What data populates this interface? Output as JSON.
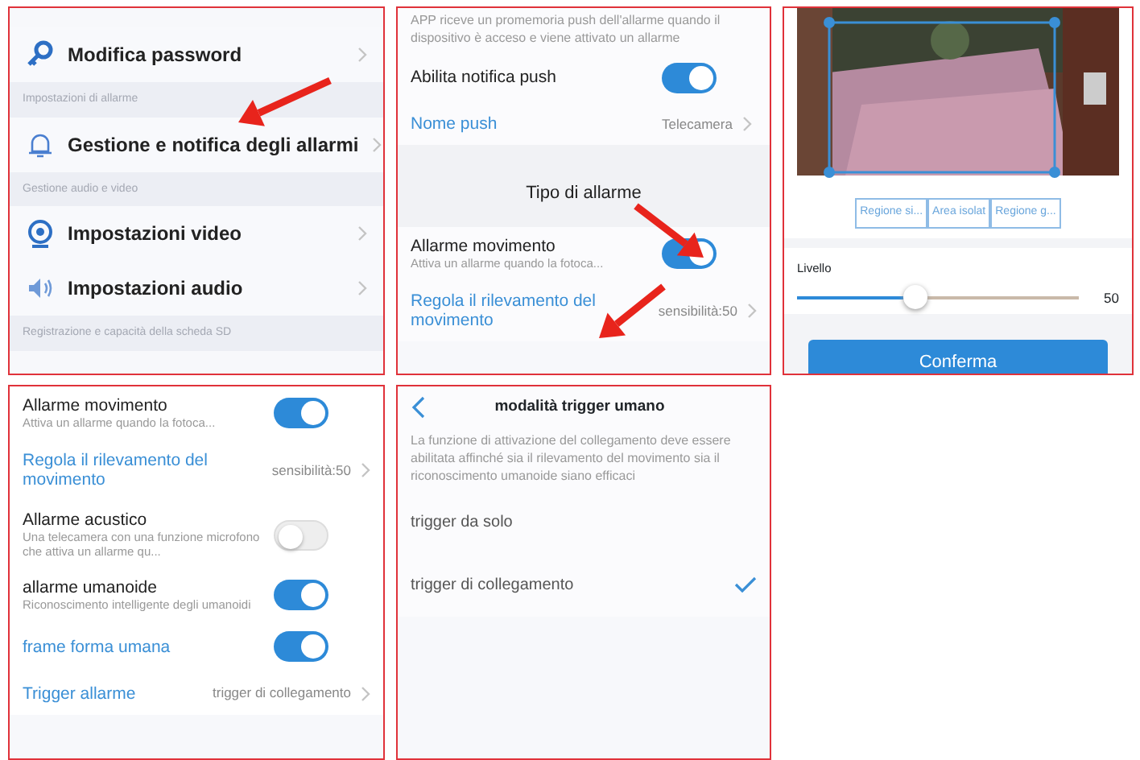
{
  "panels": [
    {
      "kind": "list",
      "rows": [
        {
          "kind": "nav",
          "label": "Modifica password"
        },
        {
          "kind": "header",
          "text": "Impostazioni di allarme"
        },
        {
          "kind": "nav",
          "label": "Gestione e notifica degli allarmi"
        },
        {
          "kind": "header",
          "text": "Gestione audio e video"
        },
        {
          "kind": "nav",
          "label": "Impostazioni video"
        },
        {
          "kind": "nav",
          "label": "Impostazioni audio"
        },
        {
          "kind": "header",
          "text": "Registrazione e capacità della scheda SD"
        }
      ]
    },
    {
      "kind": "list",
      "rows": [
        {
          "kind": "text",
          "text": "APP riceve un promemoria push dell'allarme quando il dispositivo è acceso e viene attivato un allarme"
        },
        {
          "kind": "toggle",
          "label": "Abilita notifica push",
          "on": true
        },
        {
          "kind": "link",
          "label": "Nome push",
          "value": "Telecamera"
        },
        {
          "kind": "section",
          "text": "Tipo di allarme"
        },
        {
          "kind": "toggle",
          "label": "Allarme movimento",
          "sub": "Attiva un allarme quando la fotoca...",
          "on": true
        },
        {
          "kind": "link",
          "label": "Regola il rilevamento del movimento",
          "value": "sensibilità:50"
        }
      ]
    },
    {
      "kind": "area",
      "segments": [
        "Regione si...",
        "Area isolat",
        "Regione g..."
      ],
      "slider": {
        "label": "Livello",
        "level": 0.42,
        "reading": "50"
      },
      "button": "Conferma"
    },
    {
      "kind": "list",
      "rows": [
        {
          "kind": "toggle",
          "label": "Allarme movimento",
          "sub": "Attiva un allarme quando la fotoca...",
          "on": true
        },
        {
          "kind": "link",
          "label": "Regola il rilevamento del movimento",
          "value": "sensibilità:50"
        },
        {
          "kind": "toggle",
          "label": "Allarme acustico",
          "sub": "Una telecamera con una funzione microfono che attiva un allarme qu...",
          "on": false
        },
        {
          "kind": "toggle",
          "label": "allarme umanoide",
          "sub": "Riconoscimento intelligente degli umanoidi",
          "on": true
        },
        {
          "kind": "toggle",
          "label": "frame forma umana",
          "blue": true,
          "on": true
        },
        {
          "kind": "link",
          "label": "Trigger allarme",
          "value": "trigger di collegamento"
        }
      ]
    },
    {
      "kind": "list",
      "title": "modalità trigger umano",
      "rows": [
        {
          "kind": "text",
          "text": "La funzione di attivazione del collegamento deve essere abilitata affinché sia il rilevamento del movimento sia il riconoscimento umanoide siano efficaci"
        },
        {
          "kind": "option",
          "label": "trigger da solo",
          "selected": false
        },
        {
          "kind": "option",
          "label": "trigger di collegamento",
          "selected": true
        }
      ]
    }
  ]
}
